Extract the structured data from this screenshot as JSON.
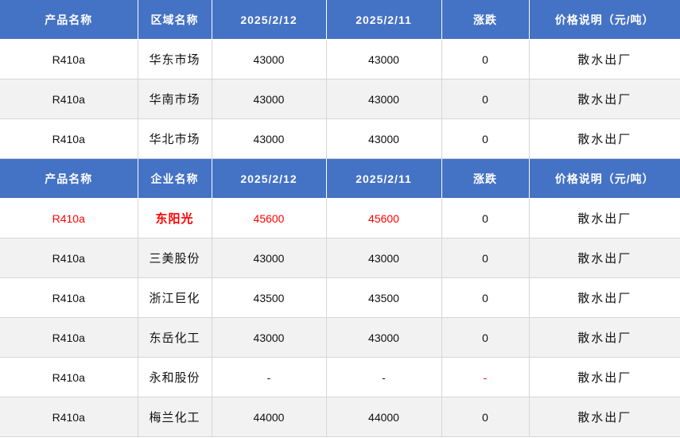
{
  "colors": {
    "header_bg": "#4472c4",
    "header_text": "#ffffff",
    "row_alt_bg": "#f2f2f2",
    "highlight": "#ff0000"
  },
  "region_table": {
    "headers": [
      "产品名称",
      "区域名称",
      "2025/2/12",
      "2025/2/11",
      "涨跌",
      "价格说明（元/吨）"
    ],
    "rows": [
      [
        "R410a",
        "华东市场",
        "43000",
        "43000",
        "0",
        "散水出厂"
      ],
      [
        "R410a",
        "华南市场",
        "43000",
        "43000",
        "0",
        "散水出厂"
      ],
      [
        "R410a",
        "华北市场",
        "43000",
        "43000",
        "0",
        "散水出厂"
      ]
    ]
  },
  "company_table": {
    "headers": [
      "产品名称",
      "企业名称",
      "2025/2/12",
      "2025/2/11",
      "涨跌",
      "价格说明（元/吨）"
    ],
    "rows": [
      [
        "R410a",
        "东阳光",
        "45600",
        "45600",
        "0",
        "散水出厂"
      ],
      [
        "R410a",
        "三美股份",
        "43000",
        "43000",
        "0",
        "散水出厂"
      ],
      [
        "R410a",
        "浙江巨化",
        "43500",
        "43500",
        "0",
        "散水出厂"
      ],
      [
        "R410a",
        "东岳化工",
        "43000",
        "43000",
        "0",
        "散水出厂"
      ],
      [
        "R410a",
        "永和股份",
        "-",
        "-",
        "-",
        "散水出厂"
      ],
      [
        "R410a",
        "梅兰化工",
        "44000",
        "44000",
        "0",
        "散水出厂"
      ]
    ]
  }
}
